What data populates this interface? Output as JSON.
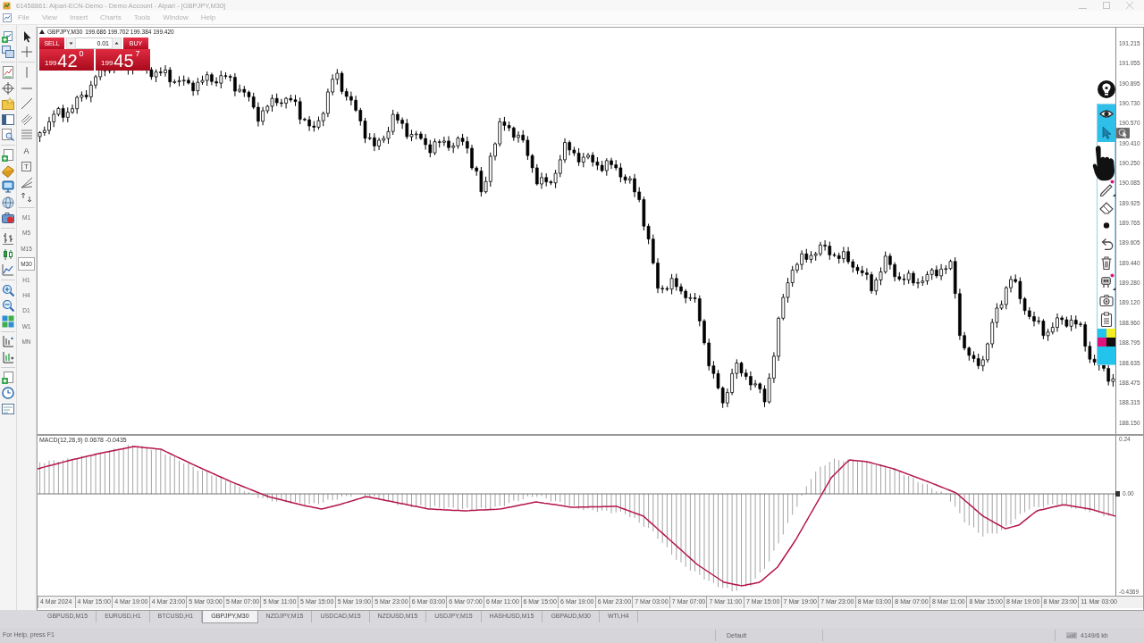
{
  "window": {
    "title": "61458861: Alpari-ECN-Demo - Demo Account - Alpari - [GBPJPY,M30]"
  },
  "menu": [
    "File",
    "View",
    "Insert",
    "Charts",
    "Tools",
    "Window",
    "Help"
  ],
  "text_tools": [
    "A",
    "T"
  ],
  "timeframes": [
    {
      "label": "M1",
      "selected": false
    },
    {
      "label": "M5",
      "selected": false
    },
    {
      "label": "M15",
      "selected": false
    },
    {
      "label": "M30",
      "selected": true
    },
    {
      "label": "H1",
      "selected": false
    },
    {
      "label": "H4",
      "selected": false
    },
    {
      "label": "D1",
      "selected": false
    },
    {
      "label": "W1",
      "selected": false
    },
    {
      "label": "MN",
      "selected": false
    }
  ],
  "chart": {
    "symbol": "GBPJPY,M30",
    "quotes": "199.686 199.702 199.384 199.420",
    "one_click_trading": {
      "sell": {
        "label": "SELL",
        "price_prefix": "199",
        "price_main": "42",
        "price_last": "0"
      },
      "volume": "0.01",
      "buy": {
        "label": "BUY",
        "price_prefix": "199",
        "price_main": "45",
        "price_last": "7"
      }
    },
    "price_axis": [
      "191.215",
      "191.055",
      "190.895",
      "190.730",
      "190.570",
      "190.410",
      "190.250",
      "190.085",
      "189.925",
      "189.765",
      "189.605",
      "189.440",
      "189.280",
      "189.120",
      "188.960",
      "188.795",
      "188.635",
      "188.475",
      "188.315",
      "188.150"
    ]
  },
  "indicator_window": {
    "label": "MACD(12,26,9) 0.0678 -0.0435",
    "axis": [
      "0.24",
      "0.00",
      "-0.4369"
    ]
  },
  "time_axis": [
    "4 Mar 2024",
    "4 Mar 15:00",
    "4 Mar 19:00",
    "4 Mar 23:00",
    "5 Mar 03:00",
    "5 Mar 07:00",
    "5 Mar 11:00",
    "5 Mar 15:00",
    "5 Mar 19:00",
    "5 Mar 23:00",
    "6 Mar 03:00",
    "6 Mar 07:00",
    "6 Mar 11:00",
    "6 Mar 15:00",
    "6 Mar 19:00",
    "6 Mar 23:00",
    "7 Mar 03:00",
    "7 Mar 07:00",
    "7 Mar 11:00",
    "7 Mar 15:00",
    "7 Mar 19:00",
    "7 Mar 23:00",
    "8 Mar 03:00",
    "8 Mar 07:00",
    "8 Mar 11:00",
    "8 Mar 15:00",
    "8 Mar 19:00",
    "8 Mar 23:00",
    "11 Mar 03:00"
  ],
  "drawing_toolbar": {
    "buttons": [
      {
        "kind": "eye",
        "selected": true
      },
      {
        "kind": "pointer",
        "selected": true
      },
      {
        "kind": "pen",
        "selected": false
      },
      {
        "kind": "eraser",
        "selected": false
      },
      {
        "kind": "dot",
        "selected": false
      },
      {
        "kind": "undo",
        "selected": false
      },
      {
        "kind": "trash",
        "selected": false
      },
      {
        "kind": "robot",
        "selected": false
      },
      {
        "kind": "camera",
        "selected": false
      },
      {
        "kind": "clipboard",
        "selected": false
      }
    ],
    "palette": [
      {
        "color": "#22c4ee"
      },
      {
        "color": "#f2ee22"
      },
      {
        "color": "#e0117a"
      },
      {
        "color": "#111111"
      }
    ],
    "pen": {
      "color": "#22c4ee"
    }
  },
  "tabs": [
    {
      "label": "GBPUSD,M15",
      "selected": false
    },
    {
      "label": "EURUSD,H1",
      "selected": false
    },
    {
      "label": "BTCUSD,H1",
      "selected": false
    },
    {
      "label": "GBPJPY,M30",
      "selected": true
    },
    {
      "label": "NZDJPY,M15",
      "selected": false
    },
    {
      "label": "USDCAD,M15",
      "selected": false
    },
    {
      "label": "NZDUSD,M15",
      "selected": false
    },
    {
      "label": "USDJPY,M15",
      "selected": false
    },
    {
      "label": "HASHUSD,M15",
      "selected": false
    },
    {
      "label": "GBPAUD,M30",
      "selected": false
    },
    {
      "label": "WTI,H4",
      "selected": false
    }
  ],
  "status_bar": {
    "help": "For Help, press F1",
    "profile": "Default",
    "traffic": "4149/6 kb"
  }
}
